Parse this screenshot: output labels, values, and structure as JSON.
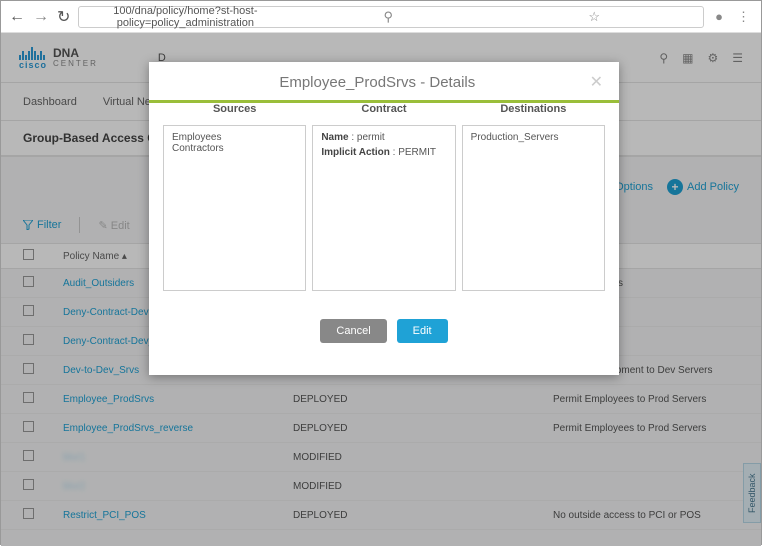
{
  "browser": {
    "url": "100/dna/policy/home?st-host-policy=policy_administration"
  },
  "logo": {
    "brand": "cisco",
    "product": "DNA",
    "sub": "CENTER"
  },
  "nav": [
    "D"
  ],
  "header_icons": [
    "search",
    "grid",
    "gear",
    "menu"
  ],
  "tabs": [
    "Dashboard",
    "Virtual Net"
  ],
  "breadcrumb": "Group-Based Access Control",
  "actions": {
    "options": "d Options",
    "add": "Add Policy"
  },
  "filter": {
    "label": "Filter",
    "edit": "Edit"
  },
  "table": {
    "headers": [
      "",
      "Policy Name",
      "",
      ""
    ],
    "rows": [
      {
        "name": "Audit_Outsiders",
        "status": "",
        "desc": "Outside Groups"
      },
      {
        "name": "Deny-Contract-Dev",
        "status": "",
        "desc": "ervers"
      },
      {
        "name": "Deny-Contract-Dev_reve",
        "status": "",
        "desc": "ervers"
      },
      {
        "name": "Dev-to-Dev_Srvs",
        "status": "DEPLOYED",
        "desc": "Permit Development to Dev Servers"
      },
      {
        "name": "Employee_ProdSrvs",
        "status": "DEPLOYED",
        "desc": "Permit Employees to Prod Servers"
      },
      {
        "name": "Employee_ProdSrvs_reverse",
        "status": "DEPLOYED",
        "desc": "Permit Employees to Prod Servers"
      },
      {
        "name": "blur1",
        "blur": true,
        "status": "MODIFIED",
        "desc": ""
      },
      {
        "name": "blur2",
        "blur": true,
        "status": "MODIFIED",
        "desc": ""
      },
      {
        "name": "Restrict_PCI_POS",
        "status": "DEPLOYED",
        "desc": "No outside access to PCI or POS"
      }
    ]
  },
  "modal": {
    "title": "Employee_ProdSrvs - Details",
    "sources_label": "Sources",
    "contract_label": "Contract",
    "dest_label": "Destinations",
    "sources": [
      "Employees",
      "Contractors"
    ],
    "contract": {
      "name_label": "Name",
      "name": "permit",
      "action_label": "Implicit Action",
      "action": "PERMIT"
    },
    "destinations": [
      "Production_Servers"
    ],
    "cancel": "Cancel",
    "edit": "Edit"
  },
  "feedback": "Feedback"
}
